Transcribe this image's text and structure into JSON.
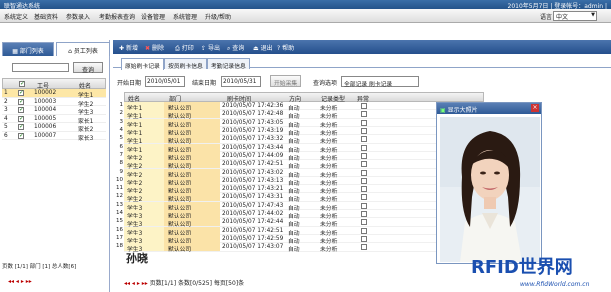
{
  "app": {
    "title": "联智通达系统",
    "status": "2010年5月7日 | 登录帐号：admin |"
  },
  "menu": {
    "items": [
      "系统定义",
      "基础资料",
      "参数录入",
      "考勤报表查询",
      "设备管理",
      "系统管理",
      "升级/帮助"
    ],
    "language_label": "语言",
    "language_value": "中文"
  },
  "left": {
    "tabs": [
      "部门列表",
      "员工列表"
    ],
    "search_button": "查询",
    "columns": [
      "",
      "工号",
      "姓名"
    ],
    "rows": [
      {
        "idx": "1",
        "id": "100002",
        "name": "学生1",
        "checked": true,
        "selected": true
      },
      {
        "idx": "2",
        "id": "100003",
        "name": "学生2",
        "checked": true,
        "selected": false
      },
      {
        "idx": "3",
        "id": "100004",
        "name": "学生3",
        "checked": true,
        "selected": false
      },
      {
        "idx": "4",
        "id": "100005",
        "name": "家长1",
        "checked": true,
        "selected": false
      },
      {
        "idx": "5",
        "id": "100006",
        "name": "家长2",
        "checked": true,
        "selected": false
      },
      {
        "idx": "6",
        "id": "100007",
        "name": "家长3",
        "checked": true,
        "selected": false
      }
    ],
    "footer": "页数 [1/1] 部门 [1] 总人数[6]",
    "pager": "◂◂ ◂ ▸ ▸▸"
  },
  "toolbar": {
    "items": [
      "新增",
      "删除",
      "打印",
      "导出",
      "查询",
      "退出",
      "帮助"
    ]
  },
  "tabs": [
    "原始刷卡记录",
    "按员刷卡信息",
    "考勤记录信息"
  ],
  "filter": {
    "start_label": "开始日期",
    "start_value": "2010/05/01",
    "end_label": "结束日期",
    "end_value": "2010/05/31",
    "collect_button": "开始采集",
    "query_label": "查询选项",
    "query_value": "全部记录 刷卡记录"
  },
  "records": {
    "columns": [
      "姓名",
      "部门",
      "刷卡时间",
      "方向",
      "记录类型",
      "异常"
    ],
    "rows": [
      [
        "学生1",
        "默认公司",
        "2010/05/07 17:42:36",
        "自动",
        "未分析"
      ],
      [
        "学生1",
        "默认公司",
        "2010/05/07 17:42:48",
        "自动",
        "未分析"
      ],
      [
        "学生1",
        "默认公司",
        "2010/05/07 17:43:05",
        "自动",
        "未分析"
      ],
      [
        "学生1",
        "默认公司",
        "2010/05/07 17:43:19",
        "自动",
        "未分析"
      ],
      [
        "学生1",
        "默认公司",
        "2010/05/07 17:43:32",
        "自动",
        "未分析"
      ],
      [
        "学生1",
        "默认公司",
        "2010/05/07 17:43:44",
        "自动",
        "未分析"
      ],
      [
        "学生2",
        "默认公司",
        "2010/05/07 17:44:09",
        "自动",
        "未分析"
      ],
      [
        "学生2",
        "默认公司",
        "2010/05/07 17:42:51",
        "自动",
        "未分析"
      ],
      [
        "学生2",
        "默认公司",
        "2010/05/07 17:43:02",
        "自动",
        "未分析"
      ],
      [
        "学生2",
        "默认公司",
        "2010/05/07 17:43:13",
        "自动",
        "未分析"
      ],
      [
        "学生2",
        "默认公司",
        "2010/05/07 17:43:21",
        "自动",
        "未分析"
      ],
      [
        "学生2",
        "默认公司",
        "2010/05/07 17:43:31",
        "自动",
        "未分析"
      ],
      [
        "学生3",
        "默认公司",
        "2010/05/07 17:47:43",
        "自动",
        "未分析"
      ],
      [
        "学生3",
        "默认公司",
        "2010/05/07 17:44:02",
        "自动",
        "未分析"
      ],
      [
        "学生3",
        "默认公司",
        "2010/05/07 17:42:44",
        "自动",
        "未分析"
      ],
      [
        "学生3",
        "默认公司",
        "2010/05/07 17:42:51",
        "自动",
        "未分析"
      ],
      [
        "学生3",
        "默认公司",
        "2010/05/07 17:42:59",
        "自动",
        "未分析"
      ],
      [
        "学生3",
        "默认公司",
        "2010/05/07 17:43:07",
        "自动",
        "未分析"
      ]
    ],
    "row_numbers": [
      "1",
      "2",
      "3",
      "4",
      "5",
      "6",
      "7",
      "8",
      "9",
      "10",
      "11",
      "12",
      "13",
      "14",
      "15",
      "16",
      "17",
      "18"
    ],
    "footer_pager": "◂◂ ◂ ▸ ▸▸",
    "footer_text": "页数[1/1] 条数[0/525] 每页[50]条"
  },
  "photo": {
    "title": "显示大照片",
    "close": "×"
  },
  "big_name": "孙晓",
  "watermark": {
    "main": "RFID世界网",
    "sub": "www.RfidWorld.com.cn"
  }
}
